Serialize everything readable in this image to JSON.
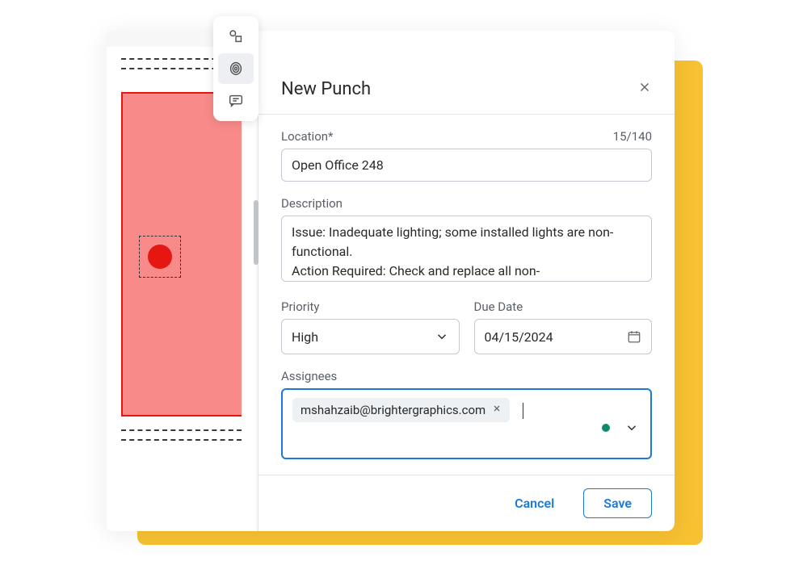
{
  "form": {
    "title": "New Punch",
    "location": {
      "label": "Location*",
      "value": "Open Office 248",
      "char_count": "15/140"
    },
    "description": {
      "label": "Description",
      "value": "Issue: Inadequate lighting; some installed lights are non-functional.\nAction Required: Check and replace all non-"
    },
    "priority": {
      "label": "Priority",
      "value": "High"
    },
    "due_date": {
      "label": "Due Date",
      "value": "04/15/2024"
    },
    "assignees": {
      "label": "Assignees",
      "chips": [
        "mshahzaib@brightergraphics.com"
      ]
    }
  },
  "footer": {
    "cancel": "Cancel",
    "save": "Save"
  },
  "toolbar": {
    "shape_tool": "shape-tool",
    "stamp_tool": "stamp-tool",
    "comment_tool": "comment-tool"
  }
}
